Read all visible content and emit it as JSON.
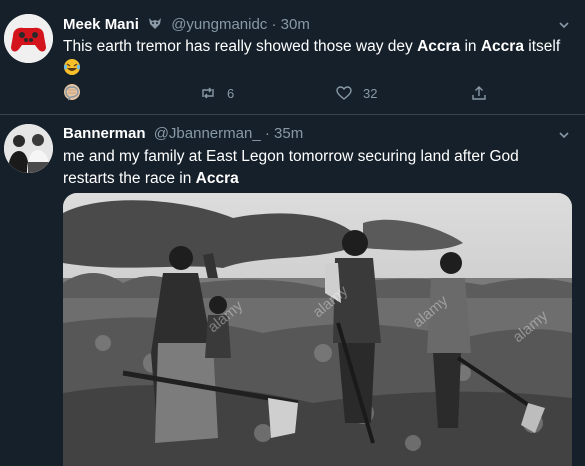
{
  "tweets": [
    {
      "name": "Meek Mani",
      "name_icon": "wolf-emoji-icon",
      "handle": "@yungmanidc",
      "dot": "·",
      "time": "30m",
      "text": {
        "part1": "This earth tremor has really showed those way dey ",
        "bold1": "Accra",
        "part2": " in ",
        "bold2": "Accra",
        "part3": " itself "
      },
      "emoji_icons": [
        "laughing-crying-emoji-icon",
        "fist-emoji-icon"
      ],
      "actions": {
        "reply_count": "",
        "retweet_count": "6",
        "like_count": "32"
      }
    },
    {
      "name": "Bannerman",
      "handle": "@Jbannerman_",
      "dot": "·",
      "time": "35m",
      "text": {
        "part1": "me and my family at East Legon tomorrow securing land after God restarts the race in ",
        "bold1": "Accra"
      },
      "media_watermark": "alamy"
    }
  ],
  "colors": {
    "background": "#15202b",
    "secondary_text": "#8899a6",
    "divider": "#38444d"
  }
}
